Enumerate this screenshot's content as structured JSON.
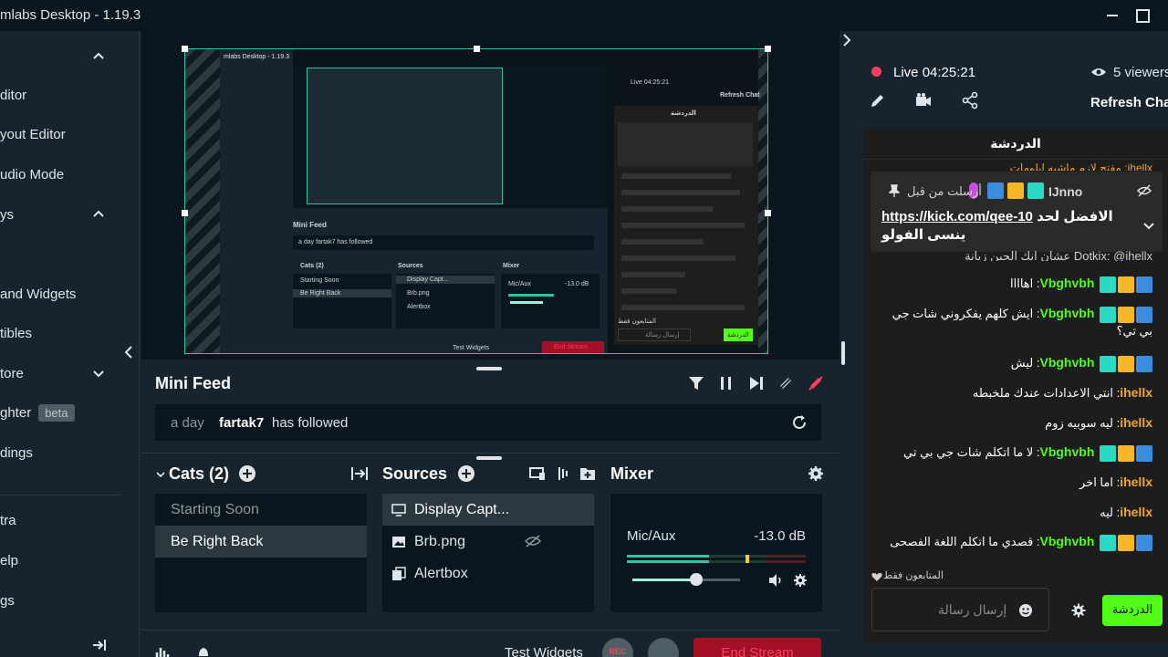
{
  "window": {
    "title": "mlabs Desktop - 1.19.3"
  },
  "nav": {
    "items": [
      {
        "label": "ditor"
      },
      {
        "label": "yout Editor"
      },
      {
        "label": "udio Mode"
      },
      {
        "label": "ys"
      },
      {
        "label": "and Widgets"
      },
      {
        "label": "tibles"
      },
      {
        "label": "tore"
      },
      {
        "label": "ghter",
        "badge": "beta"
      },
      {
        "label": "dings"
      },
      {
        "label": "tra"
      },
      {
        "label": "elp"
      },
      {
        "label": "gs"
      }
    ]
  },
  "preview": {
    "mini_title": "mlabs Desktop - 1.19.3",
    "mini_live": "Live 04:25:21",
    "mini_refresh": "Refresh Chat",
    "mini_feed": "Mini Feed",
    "mini_feed_row": "a day  fartak7  has followed",
    "mini_cats": "Cats (2)",
    "mini_sources": "Sources",
    "mini_mixer": "Mixer",
    "mini_scene1": "Starting Soon",
    "mini_scene2": "Be Right Back",
    "mini_src1": "Display Capt...",
    "mini_src2": "Brb.png",
    "mini_src3": "Alertbox",
    "mini_mic": "Mic/Aux",
    "mini_db": "-13.0 dB",
    "mini_test": "Test Widgets",
    "mini_end": "End Stream",
    "mini_chat_header": "الدردشة",
    "mini_send": "الدردشة",
    "mini_placeholder": "إرسال رسالة",
    "mini_followers": "المتابعون فقط"
  },
  "minifeed": {
    "title": "Mini Feed",
    "row": {
      "time": "a day",
      "user": "fartak7",
      "action": "has followed"
    }
  },
  "scenes": {
    "title": "Cats (2)",
    "items": [
      {
        "label": "Starting Soon",
        "active": false
      },
      {
        "label": "Be Right Back",
        "active": true
      }
    ]
  },
  "sources": {
    "title": "Sources",
    "items": [
      {
        "label": "Display Capt...",
        "icon": "monitor-icon"
      },
      {
        "label": "Brb.png",
        "icon": "image-icon"
      },
      {
        "label": "Alertbox",
        "icon": "widget-icon"
      }
    ]
  },
  "mixer": {
    "title": "Mixer",
    "channel": "Mic/Aux",
    "db": "-13.0 dB",
    "volume_level": 0.59
  },
  "footer": {
    "test_widgets": "Test Widgets",
    "rec": "REC",
    "end_stream": "End Stream"
  },
  "stream": {
    "live_label": "Live",
    "live_time": "04:25:21",
    "viewers": "5 viewers",
    "refresh_chat": "Refresh Chat"
  },
  "chat": {
    "header": "الدردشة",
    "top_partial": "ihellx: مفتح لازم ماشيه ابلومات",
    "pinned": {
      "user": "IJnno",
      "sent_before": "أرسلت من قبل",
      "link": "https://kick.com/qee-10",
      "message_rest": "الافضل لحد",
      "message_line2": "ينسى الفولو"
    },
    "partial_row": "Dotkix: @ihellx عشان انك الحين زيانة",
    "messages": [
      {
        "user": "Vbghvbh",
        "text": "اهاااا",
        "badges": true
      },
      {
        "user": "Vbghvbh",
        "text": "ايش كلهم يفكروني شات جي بي تي؟",
        "badges": true
      },
      {
        "user": "Vbghvbh",
        "text": "ليش",
        "badges": true
      },
      {
        "user": "ihellx",
        "text": "انتي الاعدادات عندك ملخبطه",
        "badges": false
      },
      {
        "user": "ihellx",
        "text": "ليه سوبيه زوم",
        "badges": false
      },
      {
        "user": "Vbghvbh",
        "text": "لا ما اتكلم شات جي بي تي",
        "badges": true
      },
      {
        "user": "ihellx",
        "text": "اما اخر",
        "badges": false
      },
      {
        "user": "ihellx",
        "text": "ليه",
        "badges": false
      },
      {
        "user": "Vbghvbh",
        "text": "قصدي ما اتكلم اللغة الفصحى",
        "badges": true
      }
    ],
    "followers_only": "المتابعون فقط",
    "input_placeholder": "إرسال رسالة",
    "send_label": "الدردشة"
  },
  "colors": {
    "accent": "#31c3a2",
    "live": "#fc3e5e",
    "kick_green": "#53fc18",
    "username_green": "#53fc18",
    "username_orange": "#f5a623"
  }
}
